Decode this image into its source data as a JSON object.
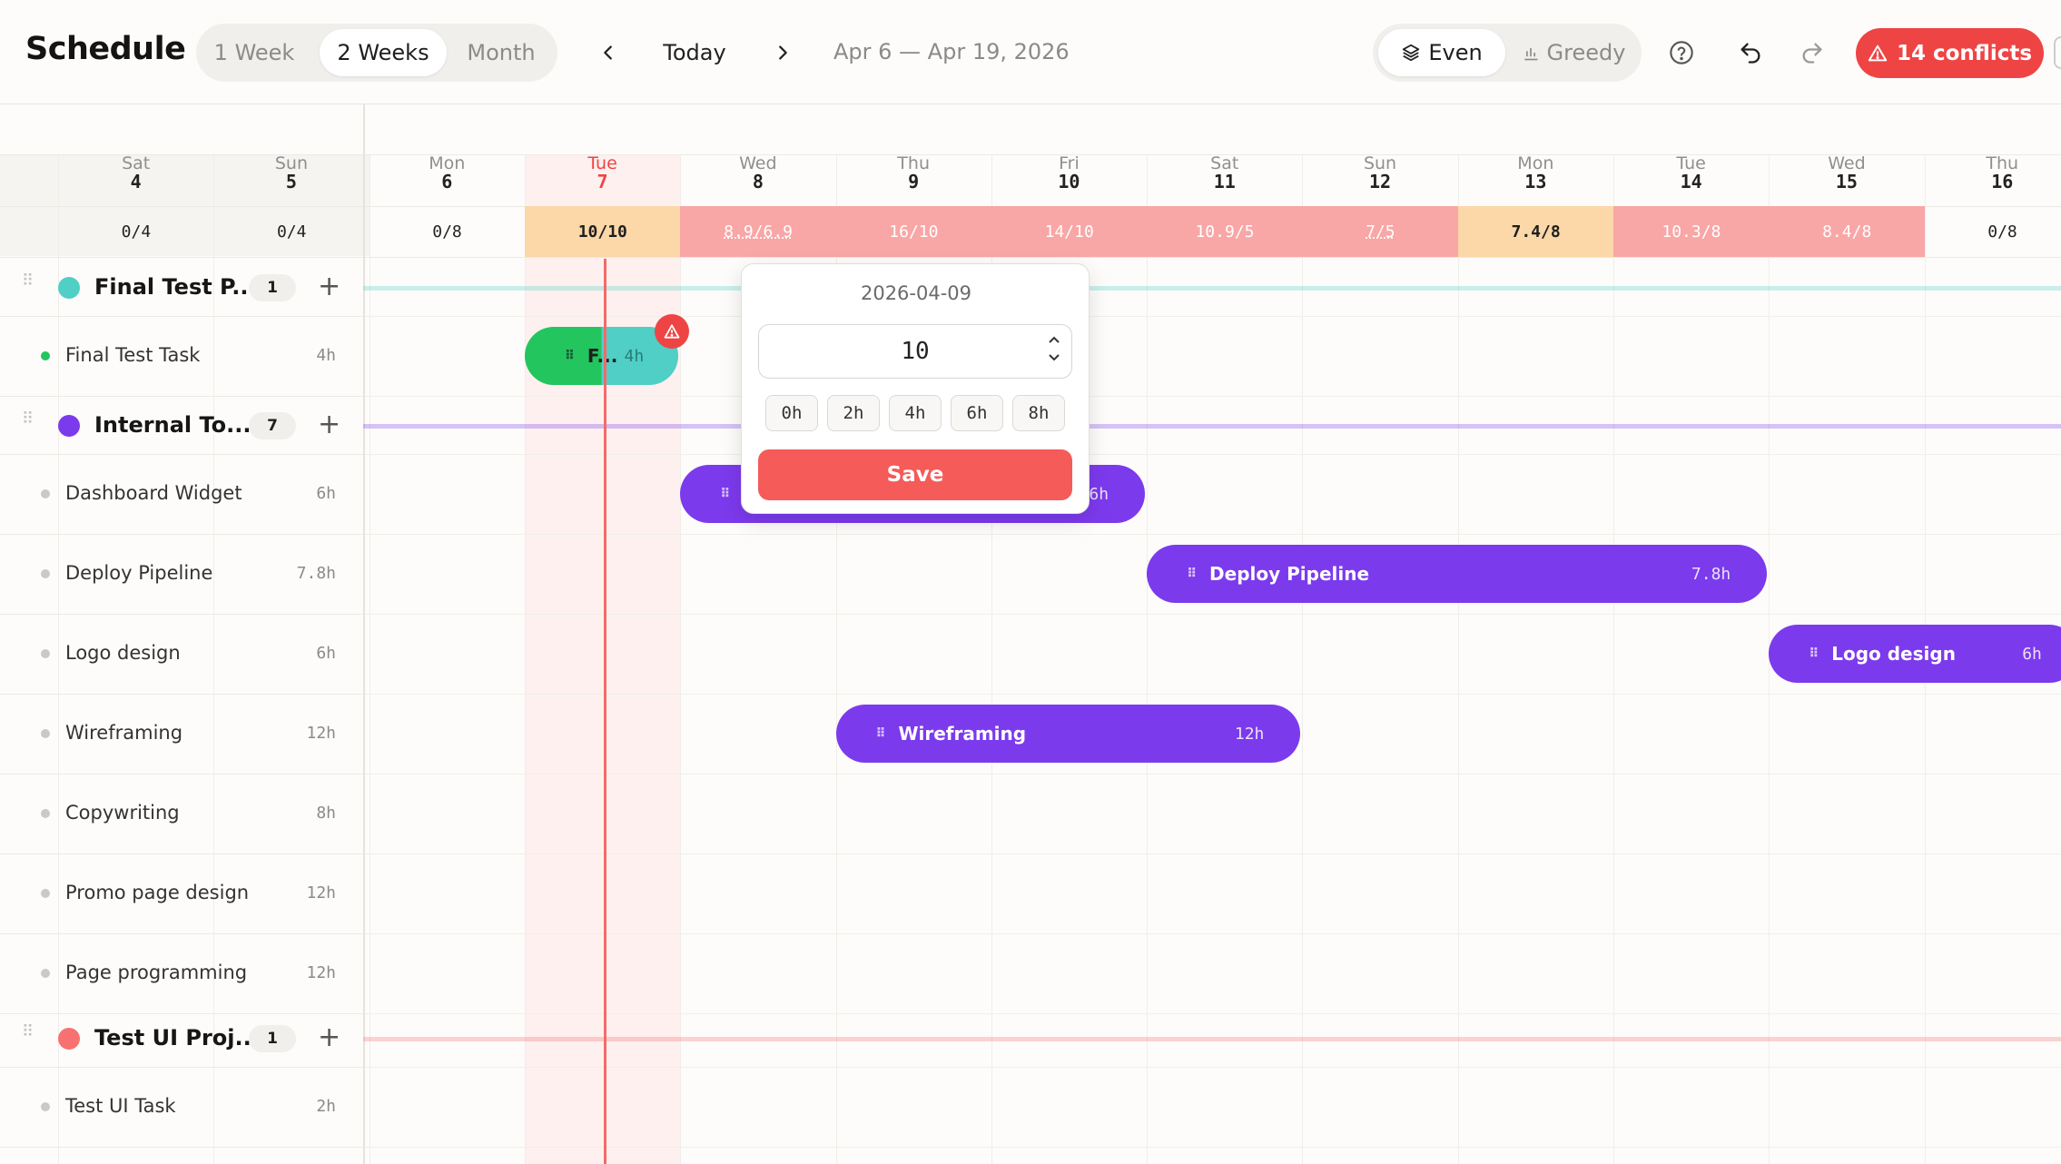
{
  "header": {
    "title": "Schedule",
    "views": [
      "1 Week",
      "2 Weeks",
      "Month"
    ],
    "active_view": "2 Weeks",
    "today_label": "Today",
    "date_range": "Apr 6 — Apr 19, 2026",
    "modes": [
      "Even",
      "Greedy"
    ],
    "active_mode": "Even",
    "conflicts_label": "14 conflicts"
  },
  "days": [
    {
      "dow": "Sat",
      "day": "4",
      "cap": "0/4",
      "state": "weekend"
    },
    {
      "dow": "Sun",
      "day": "5",
      "cap": "0/4",
      "state": "weekend"
    },
    {
      "dow": "Mon",
      "day": "6",
      "cap": "0/8",
      "state": "normal"
    },
    {
      "dow": "Tue",
      "day": "7",
      "cap": "10/10",
      "state": "today"
    },
    {
      "dow": "Wed",
      "day": "8",
      "cap": "8.9/6.9",
      "state": "over"
    },
    {
      "dow": "Thu",
      "day": "9",
      "cap": "16/10",
      "state": "over"
    },
    {
      "dow": "Fri",
      "day": "10",
      "cap": "14/10",
      "state": "over"
    },
    {
      "dow": "Sat",
      "day": "11",
      "cap": "10.9/5",
      "state": "over"
    },
    {
      "dow": "Sun",
      "day": "12",
      "cap": "7/5",
      "state": "over"
    },
    {
      "dow": "Mon",
      "day": "13",
      "cap": "7.4/8",
      "state": "warn"
    },
    {
      "dow": "Tue",
      "day": "14",
      "cap": "10.3/8",
      "state": "over"
    },
    {
      "dow": "Wed",
      "day": "15",
      "cap": "8.4/8",
      "state": "over"
    },
    {
      "dow": "Thu",
      "day": "16",
      "cap": "0/8",
      "state": "normal"
    }
  ],
  "projects": [
    {
      "name": "Final Test P...",
      "count": "1",
      "color": "#4fcfc6",
      "tasks": [
        {
          "name": "Final Test Task",
          "hours": "4h",
          "dot": "#22c55e"
        }
      ]
    },
    {
      "name": "Internal To...",
      "count": "7",
      "color": "#7c3aed",
      "tasks": [
        {
          "name": "Dashboard Widget",
          "hours": "6h"
        },
        {
          "name": "Deploy Pipeline",
          "hours": "7.8h"
        },
        {
          "name": "Logo design",
          "hours": "6h"
        },
        {
          "name": "Wireframing",
          "hours": "12h"
        },
        {
          "name": "Copywriting",
          "hours": "8h"
        },
        {
          "name": "Promo page design",
          "hours": "12h"
        },
        {
          "name": "Page programming",
          "hours": "12h"
        }
      ]
    },
    {
      "name": "Test UI Proj...",
      "count": "1",
      "color": "#f87171",
      "tasks": [
        {
          "name": "Test UI Task",
          "hours": "2h"
        }
      ]
    }
  ],
  "bars": [
    {
      "label": "F...",
      "hours": "4h"
    },
    {
      "label": "",
      "hours": "6h"
    },
    {
      "label": "Deploy Pipeline",
      "hours": "7.8h"
    },
    {
      "label": "Logo design",
      "hours": "6h"
    },
    {
      "label": "Wireframing",
      "hours": "12h"
    }
  ],
  "popover": {
    "date": "2026-04-09",
    "value": "10",
    "quick": [
      "0h",
      "2h",
      "4h",
      "6h",
      "8h"
    ],
    "save_label": "Save"
  },
  "colors": {
    "accent": "#ef4444",
    "purple": "#7c3aed",
    "teal": "#4fcfc6",
    "green": "#22c55e"
  }
}
